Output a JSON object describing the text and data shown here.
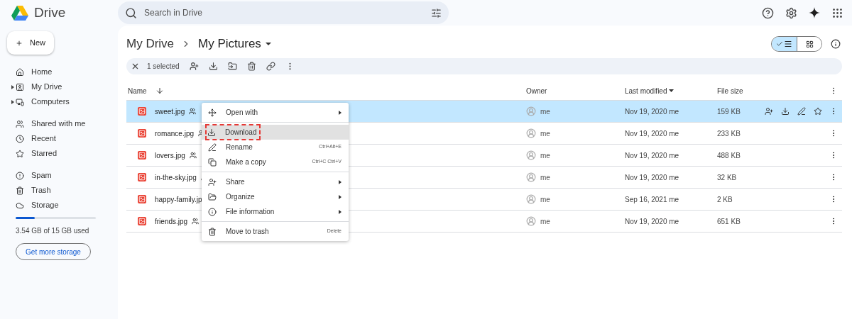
{
  "app": {
    "name": "Drive"
  },
  "search": {
    "placeholder": "Search in Drive"
  },
  "new_button": {
    "label": "New"
  },
  "sidebar": {
    "groups": [
      [
        {
          "label": "Home",
          "expandable": false
        },
        {
          "label": "My Drive",
          "expandable": true
        },
        {
          "label": "Computers",
          "expandable": true
        }
      ],
      [
        {
          "label": "Shared with me",
          "expandable": false
        },
        {
          "label": "Recent",
          "expandable": false
        },
        {
          "label": "Starred",
          "expandable": false
        }
      ],
      [
        {
          "label": "Spam",
          "expandable": false
        },
        {
          "label": "Trash",
          "expandable": false
        },
        {
          "label": "Storage",
          "expandable": false
        }
      ]
    ]
  },
  "storage": {
    "level": 0.236,
    "text": "3.54 GB of 15 GB used",
    "button": "Get more storage"
  },
  "breadcrumb": [
    "My Drive",
    "My Pictures"
  ],
  "view_toggle": [
    {
      "kind": "list",
      "selected": true
    },
    {
      "kind": "grid",
      "selected": false
    }
  ],
  "selection_bar": {
    "count": "1 selected"
  },
  "table": {
    "columns": [
      "Name",
      "Owner",
      "Last modified",
      "File size"
    ],
    "rows": [
      {
        "name": "sweet.jpg",
        "shared": true,
        "owner": "me",
        "modified": "Nov 19, 2020 me",
        "size": "159 KB",
        "selected": true
      },
      {
        "name": "romance.jpg",
        "shared": true,
        "owner": "me",
        "modified": "Nov 19, 2020 me",
        "size": "233 KB",
        "selected": false
      },
      {
        "name": "lovers.jpg",
        "shared": true,
        "owner": "me",
        "modified": "Nov 19, 2020 me",
        "size": "488 KB",
        "selected": false
      },
      {
        "name": "in-the-sky.jpg",
        "shared": true,
        "owner": "me",
        "modified": "Nov 19, 2020 me",
        "size": "32 KB",
        "selected": false
      },
      {
        "name": "happy-family.jp",
        "owner": "me",
        "modified": "Sep 16, 2021 me",
        "size": "2 KB",
        "selected": false
      },
      {
        "name": "friends.jpg",
        "shared": true,
        "owner": "me",
        "modified": "Nov 19, 2020 me",
        "size": "651 KB",
        "selected": false
      }
    ]
  },
  "context_menu": {
    "sections": [
      [
        {
          "label": "Open with",
          "submenu": true,
          "highlighted": false
        }
      ],
      [
        {
          "label": "Download",
          "submenu": false,
          "highlighted": true
        },
        {
          "label": "Rename",
          "shortcut": "Ctrl+Alt+E",
          "submenu": false,
          "highlighted": false
        },
        {
          "label": "Make a copy",
          "shortcut": "Ctrl+C Ctrl+V",
          "submenu": false,
          "highlighted": false
        }
      ],
      [
        {
          "label": "Share",
          "submenu": true,
          "highlighted": false
        },
        {
          "label": "Organize",
          "submenu": true,
          "highlighted": false
        },
        {
          "label": "File information",
          "submenu": true,
          "highlighted": false
        }
      ],
      [
        {
          "label": "Move to trash",
          "shortcut": "Delete",
          "submenu": false,
          "highlighted": false
        }
      ]
    ]
  }
}
